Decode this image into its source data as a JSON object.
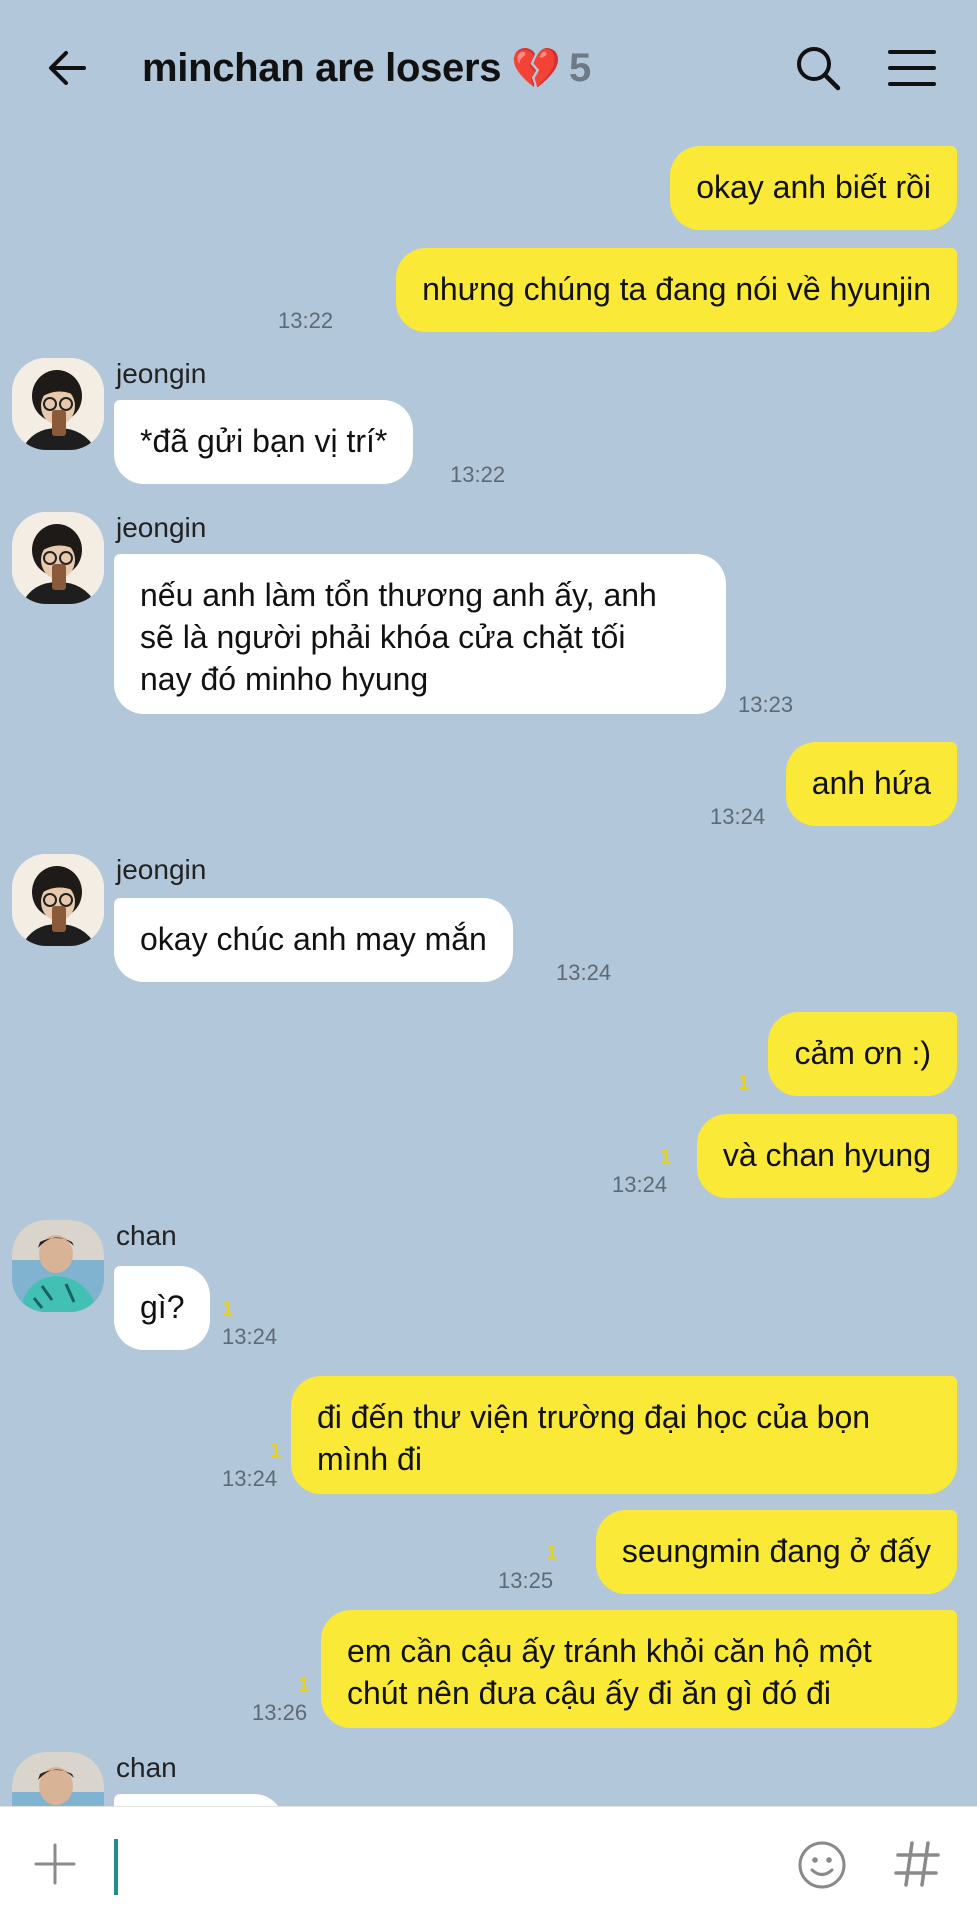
{
  "header": {
    "title": "minchan are losers",
    "emoji": "💔",
    "member_count": "5"
  },
  "messages": {
    "m1": {
      "text": "okay anh biết rồi"
    },
    "m2": {
      "text": "nhưng chúng ta đang nói về hyunjin",
      "time": "13:22"
    },
    "m3": {
      "sender": "jeongin",
      "text": "*đã gửi bạn vị trí*",
      "time": "13:22"
    },
    "m4": {
      "sender": "jeongin",
      "lines": [
        "nếu anh làm tổn thương anh ấy, anh",
        "sẽ là người phải khóa cửa chặt tối",
        "nay đó minho hyung"
      ],
      "time": "13:23"
    },
    "m5": {
      "text": "anh hứa",
      "time": "13:24"
    },
    "m6": {
      "sender": "jeongin",
      "text": "okay chúc anh may mắn",
      "time": "13:24"
    },
    "m7": {
      "text": "cảm ơn :)",
      "unread": "1"
    },
    "m8": {
      "text": "và chan hyung",
      "unread": "1",
      "time": "13:24"
    },
    "m9": {
      "sender": "chan",
      "text": "gì?",
      "unread": "1",
      "time": "13:24"
    },
    "m10": {
      "lines": [
        "đi đến thư viện trường đại học của bọn",
        "mình đi"
      ],
      "unread": "1",
      "time": "13:24"
    },
    "m11": {
      "text": "seungmin đang ở đấy",
      "unread": "1",
      "time": "13:25"
    },
    "m12": {
      "lines": [
        "em cần cậu ấy tránh khỏi căn hộ một",
        "chút nên đưa cậu ấy đi ăn gì đó đi"
      ],
      "unread": "1",
      "time": "13:26"
    },
    "m13": {
      "sender": "chan"
    }
  },
  "input": {
    "placeholder": ""
  },
  "icons": {
    "back": "arrow-left-icon",
    "search": "search-icon",
    "menu": "hamburger-menu-icon",
    "plus": "plus-icon",
    "emoji": "smiley-icon",
    "hash": "hashtag-icon"
  },
  "colors": {
    "background": "#b2c7d9",
    "outgoing_bubble": "#fbe937",
    "incoming_bubble": "#ffffff",
    "unread_count": "#e5d21e",
    "caret": "#1f8f8c"
  }
}
